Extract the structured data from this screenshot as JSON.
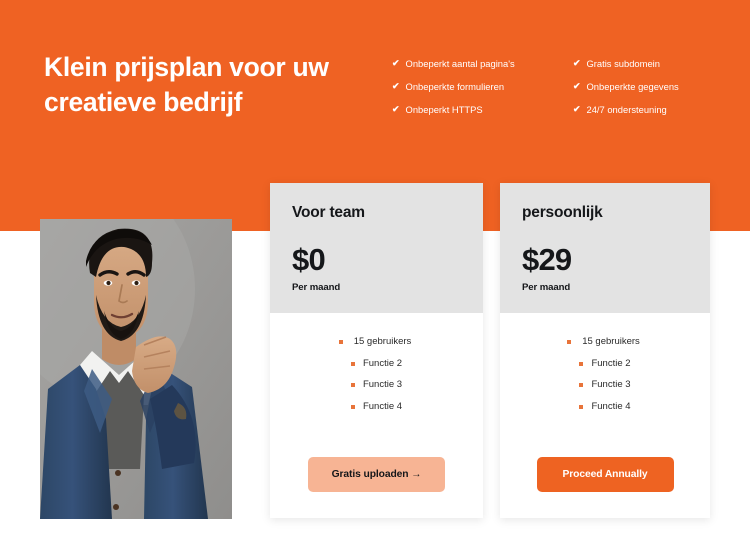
{
  "hero": {
    "title": "Klein prijsplan voor uw creatieve bedrijf",
    "background_color": "#ef6223",
    "check_icon": "✔",
    "features_left": [
      "Onbeperkt aantal pagina's",
      "Onbeperkte formulieren",
      "Onbeperkt HTTPS"
    ],
    "features_right": [
      "Gratis subdomein",
      "Onbeperkte gegevens",
      "24/7 ondersteuning"
    ]
  },
  "photo": {
    "alt": "Man in blue blazer posing against gray backdrop"
  },
  "cards": [
    {
      "name": "Voor team",
      "price": "$0",
      "period": "Per maand",
      "features": [
        "15 gebruikers",
        "Functie 2",
        "Functie 3",
        "Functie 4"
      ],
      "cta_label": "Gratis uploaden →",
      "cta_style": "secondary",
      "cta_color": "#f7b494"
    },
    {
      "name": "persoonlijk",
      "price": "$29",
      "period": "Per maand",
      "features": [
        "15 gebruikers",
        "Functie 2",
        "Functie 3",
        "Functie 4"
      ],
      "cta_label": "Proceed Annually",
      "cta_style": "primary",
      "cta_color": "#ee6322"
    }
  ],
  "colors": {
    "accent": "#ef6223",
    "card_header": "#e3e3e3",
    "bullet": "#e8743a",
    "text_dark": "#15171a"
  }
}
